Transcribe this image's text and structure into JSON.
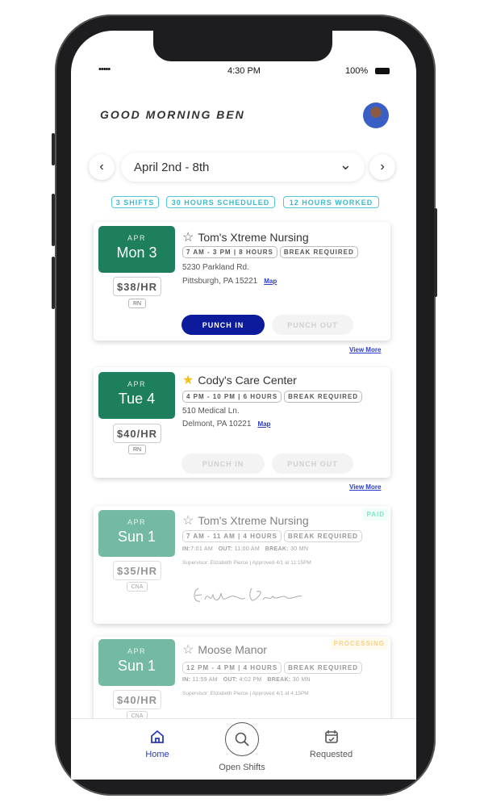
{
  "status_bar": {
    "signal": "•••••",
    "time": "4:30 PM",
    "battery": "100%"
  },
  "header": {
    "greeting": "GOOD MORNING BEN"
  },
  "week_selector": {
    "label": "April 2nd - 8th",
    "prev": "‹",
    "next": "›",
    "dropdown": "⌄"
  },
  "summary_chips": [
    "3 SHIFTS",
    "30 HOURS SCHEDULED",
    "12 HOURS WORKED"
  ],
  "colors": {
    "accent": "#0c1a9c",
    "date_green": "#1e7f5c",
    "chip_cyan": "#3cb8c8",
    "paid": "#2bd9a0",
    "processing": "#f2b63a"
  },
  "shifts": [
    {
      "month": "APR",
      "day": "Mon 3",
      "pay": "$38/HR",
      "role": "RN",
      "facility": "Tom's Xtreme Nursing",
      "favorite": false,
      "time": "7 AM - 3 PM | 8 HOURS",
      "break": "BREAK REQUIRED",
      "address1": "5230 Parkland Rd.",
      "address2": "Pittsburgh, PA 15221",
      "map": "Map",
      "punch_in": "PUNCH IN",
      "punch_out": "PUNCH OUT",
      "view_more": "View More"
    },
    {
      "month": "APR",
      "day": "Tue 4",
      "pay": "$40/HR",
      "role": "RN",
      "facility": "Cody's Care Center",
      "favorite": true,
      "time": "4 PM - 10 PM | 6 HOURS",
      "break": "BREAK REQUIRED",
      "address1": "510 Medical Ln.",
      "address2": "Delmont, PA 10221",
      "map": "Map",
      "punch_in": "PUNCH IN",
      "punch_out": "PUNCH OUT",
      "view_more": "View More"
    },
    {
      "month": "APR",
      "day": "Sun 1",
      "pay": "$35/HR",
      "role": "CNA",
      "facility": "Tom's Xtreme Nursing",
      "favorite": false,
      "time": "7 AM - 11 AM | 4 HOURS",
      "break": "BREAK REQUIRED",
      "in_label": "IN:",
      "in": "7:01 AM",
      "out_label": "OUT:",
      "out": "11:00 AM",
      "break_label": "BREAK:",
      "break_len": "30 MN",
      "supervisor": "Supervisor: Elizabeth Pierce | Approved 4/1 at 11:15PM",
      "signature": "Elizabeth Pierce",
      "status": "PAID"
    },
    {
      "month": "APR",
      "day": "Sun 1",
      "pay": "$40/HR",
      "role": "CNA",
      "facility": "Moose Manor",
      "favorite": false,
      "time": "12 PM - 4 PM | 4 HOURS",
      "break": "BREAK REQUIRED",
      "in_label": "IN:",
      "in": "11:59 AM",
      "out_label": "OUT:",
      "out": "4:02 PM",
      "break_label": "BREAK:",
      "break_len": "30 MN",
      "supervisor": "Supervisor: Elizabeth Pierce | Approved 4/1 at 4:15PM",
      "status": "PROCESSING"
    }
  ],
  "bottom_nav": [
    {
      "label": "Home",
      "icon": "home-icon",
      "active": true
    },
    {
      "label": "Open Shifts",
      "icon": "search-icon"
    },
    {
      "label": "Requested",
      "icon": "calendar-icon"
    }
  ]
}
